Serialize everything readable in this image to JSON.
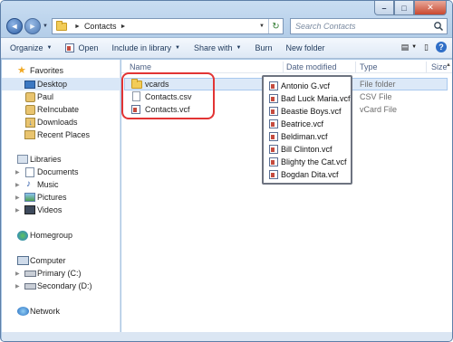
{
  "window": {
    "caption": {
      "minimize": "–",
      "maximize": "□",
      "close": "✕"
    }
  },
  "nav": {
    "back": "◄",
    "forward": "►",
    "dropdown": "▼"
  },
  "address": {
    "path": [
      "Contacts"
    ],
    "separator": "►",
    "dropdown": "▼",
    "refresh": "↻"
  },
  "search": {
    "placeholder": "Search Contacts"
  },
  "toolbar": {
    "items": [
      {
        "label": "Organize",
        "dropdown": true
      },
      {
        "label": "Open",
        "dropdown": false
      },
      {
        "label": "Include in library",
        "dropdown": true
      },
      {
        "label": "Share with",
        "dropdown": true
      },
      {
        "label": "Burn",
        "dropdown": false
      },
      {
        "label": "New folder",
        "dropdown": false
      }
    ],
    "arrow": "▼",
    "view_icon": "▤",
    "view_arrow": "▼",
    "preview_icon": "▯",
    "help_icon": "?"
  },
  "navpane": {
    "favorites": {
      "label": "Favorites",
      "icon": "star-icon"
    },
    "favorite_items": [
      "Desktop",
      "Paul",
      "ReIncubate",
      "Downloads",
      "Recent Places"
    ],
    "libraries": {
      "label": "Libraries"
    },
    "library_items": [
      "Documents",
      "Music",
      "Pictures",
      "Videos"
    ],
    "homegroup": "Homegroup",
    "computer": {
      "label": "Computer"
    },
    "computer_items": [
      "Primary (C:)",
      "Secondary (D:)"
    ],
    "network": "Network",
    "expander": "▶"
  },
  "columns": {
    "name": "Name",
    "date_modified": "Date modified",
    "type": "Type",
    "size": "Size"
  },
  "files": [
    {
      "name": "vcards",
      "type": "File folder",
      "icon": "folder-icon"
    },
    {
      "name": "Contacts.csv",
      "type": "CSV File",
      "icon": "document-icon"
    },
    {
      "name": "Contacts.vcf",
      "type": "vCard File",
      "icon": "vcard-icon"
    }
  ],
  "popup_files": [
    "Antonio G.vcf",
    "Bad Luck Maria.vcf",
    "Beastie Boys.vcf",
    "Beatrice.vcf",
    "Beldiman.vcf",
    "Bill Clinton.vcf",
    "Blighty the Cat.vcf",
    "Bogdan Dita.vcf"
  ],
  "scroll_up": "▲"
}
